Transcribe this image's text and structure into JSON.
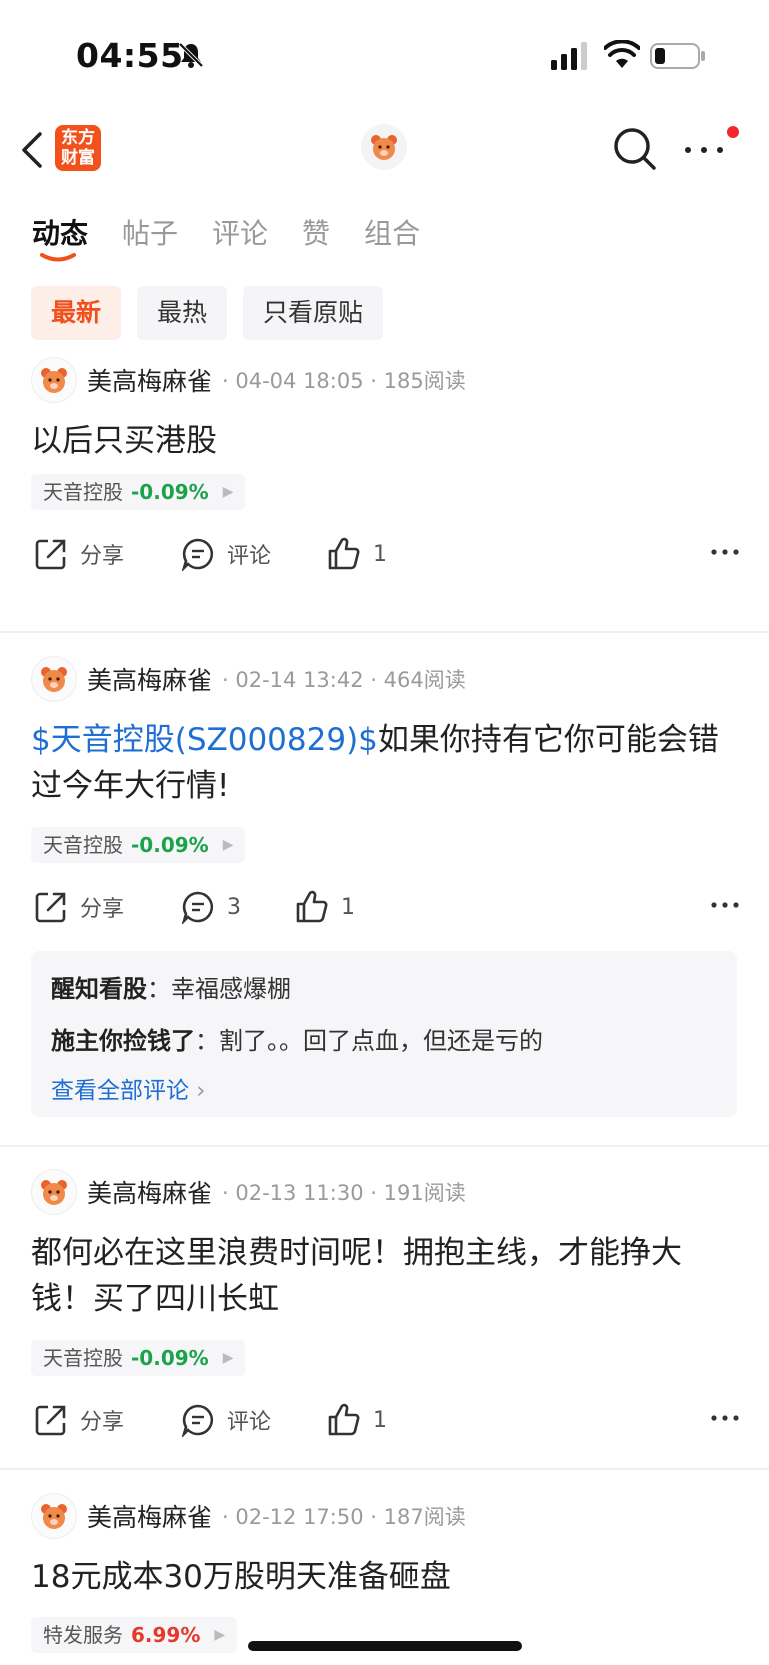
{
  "status": {
    "time": "04:55"
  },
  "nav": {
    "logo_line1": "东方",
    "logo_line2": "财富"
  },
  "tabs": [
    "动态",
    "帖子",
    "评论",
    "赞",
    "组合"
  ],
  "filters": [
    "最新",
    "最热",
    "只看原贴"
  ],
  "posts": [
    {
      "author": "美高梅麻雀",
      "meta": "· 04-04 18:05 · 185阅读",
      "text": "以后只买港股",
      "link": "",
      "stock": {
        "name": "天音控股",
        "change": "-0.09%"
      },
      "share": "分享",
      "comment": "评论",
      "likes": "1"
    },
    {
      "author": "美高梅麻雀",
      "meta": "· 02-14 13:42 · 464阅读",
      "link": "$天音控股(SZ000829)$",
      "text": "如果你持有它你可能会错过今年大行情!",
      "stock": {
        "name": "天音控股",
        "change": "-0.09%"
      },
      "share": "分享",
      "comment": "3",
      "likes": "1",
      "comments": [
        {
          "user": "醒知看股",
          "text": "幸福感爆棚"
        },
        {
          "user": "施主你捡钱了",
          "text": "割了。。回了点血，但还是亏的"
        }
      ],
      "view_all": "查看全部评论"
    },
    {
      "author": "美高梅麻雀",
      "meta": "· 02-13 11:30 · 191阅读",
      "text": "都何必在这里浪费时间呢！拥抱主线，才能挣大钱！买了四川长虹",
      "link": "",
      "stock": {
        "name": "天音控股",
        "change": "-0.09%"
      },
      "share": "分享",
      "comment": "评论",
      "likes": "1"
    },
    {
      "author": "美高梅麻雀",
      "meta": "· 02-12 17:50 · 187阅读",
      "text": "18元成本30万股明天准备砸盘",
      "link": "",
      "stock": {
        "name": "特发服务",
        "change": "6.99%"
      }
    }
  ],
  "colors": {
    "accent": "#f0501c",
    "link": "#1f6ed4",
    "down": "#1aa34a",
    "up": "#e4392b"
  },
  "icons": [
    "chevron-left-icon",
    "bear-avatar-icon",
    "search-icon",
    "more-icon",
    "share-icon",
    "comment-icon",
    "like-icon"
  ]
}
